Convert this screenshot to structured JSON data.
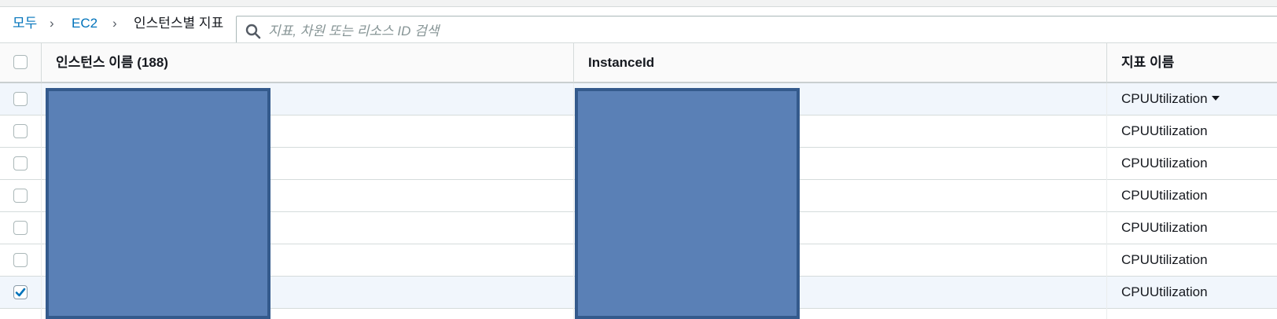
{
  "breadcrumb": {
    "items": [
      {
        "label": "모두",
        "type": "link"
      },
      {
        "label": "EC2",
        "type": "link"
      },
      {
        "label": "인스턴스별 지표",
        "type": "current"
      }
    ],
    "separator": "›"
  },
  "search": {
    "placeholder": "지표, 차원 또는 리소스 ID 검색",
    "value": ""
  },
  "table": {
    "columns": [
      {
        "label": "인스턴스 이름 (188)"
      },
      {
        "label": "InstanceId"
      },
      {
        "label": "지표 이름"
      }
    ],
    "rows": [
      {
        "instance_name": "",
        "instance_id": "",
        "metric_name": "CPUUtilization",
        "checked": false,
        "has_dropdown": true
      },
      {
        "instance_name": "",
        "instance_id": "",
        "metric_name": "CPUUtilization",
        "checked": false
      },
      {
        "instance_name": "",
        "instance_id": "",
        "metric_name": "CPUUtilization",
        "checked": false
      },
      {
        "instance_name": "",
        "instance_id": "",
        "metric_name": "CPUUtilization",
        "checked": false
      },
      {
        "instance_name": "",
        "instance_id": "",
        "metric_name": "CPUUtilization",
        "checked": false
      },
      {
        "instance_name": "",
        "instance_id": "",
        "metric_name": "CPUUtilization",
        "checked": false
      },
      {
        "instance_name": "",
        "instance_id": "",
        "metric_name": "CPUUtilization",
        "checked": true
      }
    ]
  },
  "icons": {
    "search": "search-icon",
    "dropdown": "caret-down-icon",
    "check": "checkmark-icon"
  },
  "colors": {
    "link": "#0073bb",
    "redaction": "#5a80b6",
    "row_highlight": "#f1f6fc"
  }
}
